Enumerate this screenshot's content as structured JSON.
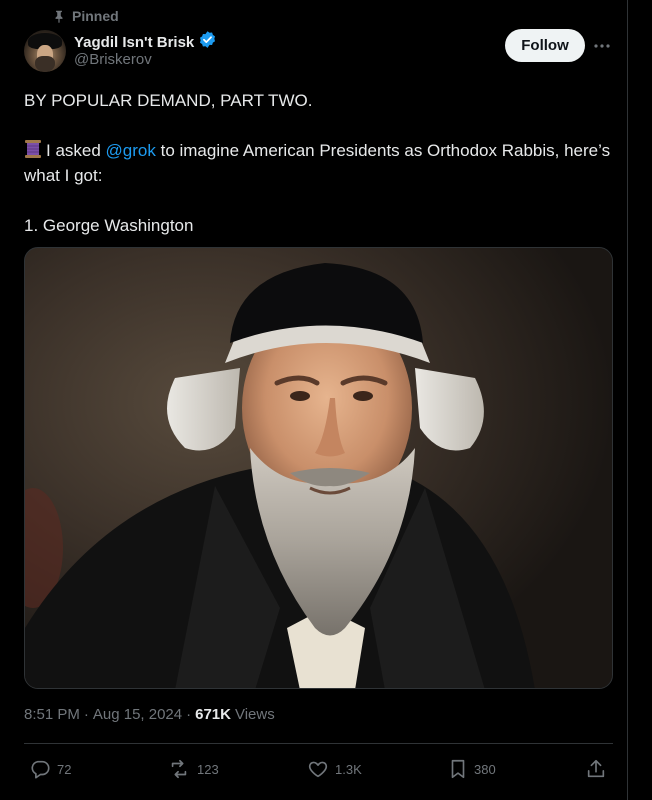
{
  "pinned": {
    "label": "Pinned",
    "icon": "pin-icon"
  },
  "author": {
    "display_name": "Yagdil Isn't Brisk",
    "handle": "@Briskerov",
    "verified": true,
    "verified_color": "#1d9bf0",
    "avatar_icon": "avatar"
  },
  "follow_button": {
    "label": "Follow"
  },
  "more_button": {
    "icon": "more-icon"
  },
  "tweet": {
    "line1": "BY POPULAR DEMAND, PART TWO.",
    "line2_prefix_emoji": "spool-of-thread-emoji",
    "line2_before_mention": "I asked ",
    "mention": "@grok",
    "line2_after_mention": " to imagine American Presidents as Orthodox Rabbis, here’s what I got:",
    "line3": "1. George Washington"
  },
  "media": {
    "type": "image",
    "subject": "portrait of an elderly man with a white beard and black skullcap"
  },
  "meta": {
    "time": "8:51 PM",
    "separator": "·",
    "date": "Aug 15, 2024",
    "views_count": "671K",
    "views_label": "Views"
  },
  "actions": {
    "reply": {
      "icon": "reply-icon",
      "count": "72"
    },
    "retweet": {
      "icon": "retweet-icon",
      "count": "123"
    },
    "like": {
      "icon": "heart-icon",
      "count": "1.3K"
    },
    "bookmark": {
      "icon": "bookmark-icon",
      "count": "380"
    },
    "share": {
      "icon": "share-icon"
    }
  },
  "colors": {
    "background": "#000000",
    "text_primary": "#e7e9ea",
    "text_secondary": "#71767b",
    "link": "#1d9bf0",
    "border": "#2f3336",
    "follow_bg": "#eff3f4"
  }
}
